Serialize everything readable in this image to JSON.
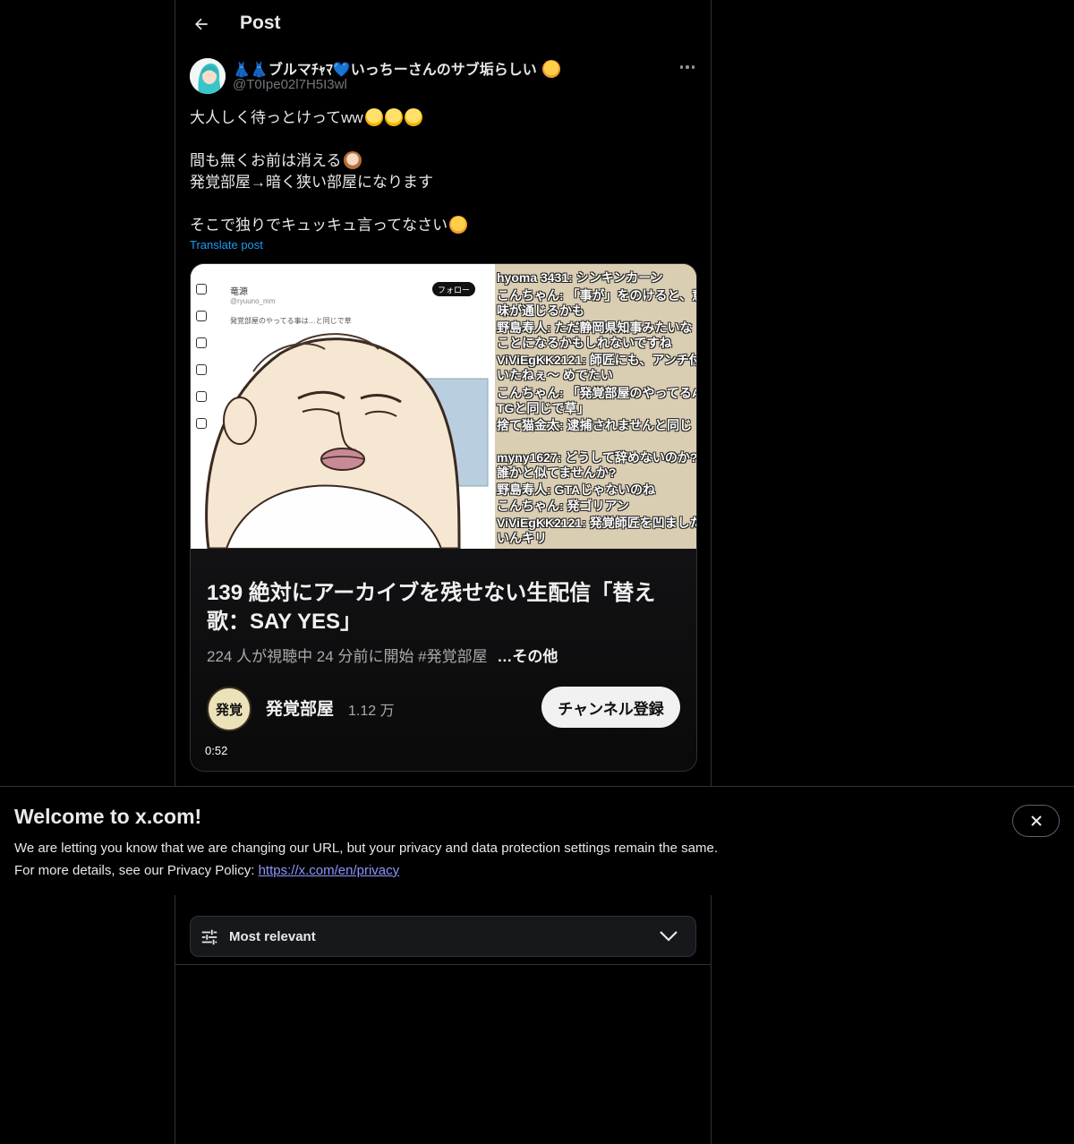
{
  "header": {
    "title": "Post"
  },
  "post": {
    "display_name": "👗👗ブルマﾁｬﾏ💙いっちーさんのサブ垢らしい",
    "handle": "@T0Ipe02l7H5I3wl",
    "lines": [
      "大人しく待っとけってww",
      "",
      "間も無くお前は消える",
      "発覚部屋→暗く狭い部屋になります",
      "",
      "そこで独りでキュッキュ言ってなさい"
    ],
    "translate_label": "Translate post"
  },
  "media": {
    "embedded_screenshot": {
      "mini_user": "竜源",
      "mini_handle": "@ryuuno_mm",
      "follow_label": "フォロー",
      "tweet_text": "発覚部屋のやってる事は…と同じで草"
    },
    "chat": [
      "hyoma 3431: シンキンカーン",
      "こんちゃん: 「事が」をのけると、意",
      "味が通じるかも",
      "野島寿人: ただ静岡県知事みたいな",
      "ことになるかもしれないですね",
      "ViViEgKK2121: 師匠にも、アンチ付",
      "いたねぇ〜 めでたい",
      "こんちゃん: 「発覚部屋のやってるA",
      "TGと同じで草」",
      "捨て猫金太: 逮捕されませんと同じ",
      "myny1627: どうして辞めないのか?",
      "誰かと似てませんか?",
      "野島寿人: GTAじゃないのね",
      "こんちゃん: 発ゴリアン",
      "ViViEgKK2121: 発覚師匠を凹ました",
      "いんキリ"
    ],
    "stream_title": "139 絶対にアーカイブを残せない生配信「替え歌：SAY YES」",
    "stream_meta": "224 人が視聴中  24 分前に開始  #発覚部屋",
    "more_label": "…その他",
    "channel_logo_text": "発覚",
    "channel_name": "発覚部屋",
    "subscriber_count": "1.12 万",
    "subscribe_label": "チャンネル登録",
    "duration": "0:52"
  },
  "cookie_banner": {
    "title": "Welcome to x.com!",
    "line1": "We are letting you know that we are changing our URL, but your privacy and data protection settings remain the same.",
    "line2_prefix": "For more details, see our Privacy Policy: ",
    "link": "https://x.com/en/privacy"
  },
  "replies": {
    "sort_label": "Most relevant"
  },
  "colors": {
    "accent": "#1d9bf0",
    "background": "#000000",
    "border": "#2f3336",
    "link_in_banner": "#8f95ff"
  },
  "icons": {
    "back": "arrow-left-icon",
    "more": "more-horizontal-icon",
    "close": "close-icon",
    "sort": "sliders-icon",
    "dropdown": "chevron-down-icon"
  }
}
